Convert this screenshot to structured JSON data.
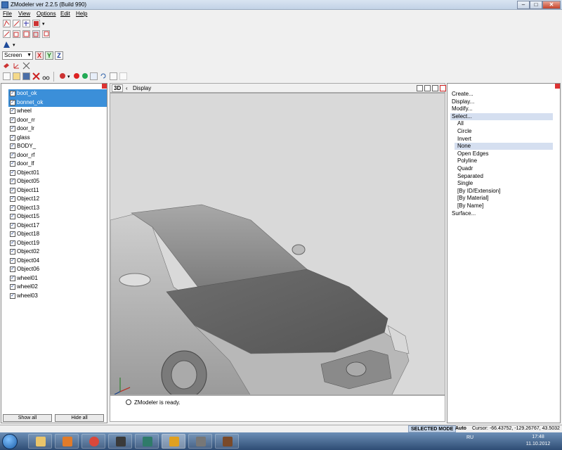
{
  "window": {
    "title": "ZModeler ver 2.2.5 (Build 990)",
    "min": "–",
    "max": "□",
    "close": "✕"
  },
  "menu": [
    "File",
    "View",
    "Options",
    "Edit",
    "Help"
  ],
  "toolbar": {
    "coord_mode": "Screen",
    "axes": [
      "X",
      "Y",
      "Z"
    ]
  },
  "objects": {
    "items": [
      {
        "label": "boot_ok",
        "selected": true
      },
      {
        "label": "bonnet_ok",
        "selected": true
      },
      {
        "label": "wheel"
      },
      {
        "label": "door_rr"
      },
      {
        "label": "door_lr"
      },
      {
        "label": "glass"
      },
      {
        "label": "BODY_"
      },
      {
        "label": "door_rf"
      },
      {
        "label": "door_lf"
      },
      {
        "label": "Object01"
      },
      {
        "label": "Object05"
      },
      {
        "label": "Object11"
      },
      {
        "label": "Object12"
      },
      {
        "label": "Object13"
      },
      {
        "label": "Object15"
      },
      {
        "label": "Object17"
      },
      {
        "label": "Object18"
      },
      {
        "label": "Object19"
      },
      {
        "label": "Object02"
      },
      {
        "label": "Object04"
      },
      {
        "label": "Object06"
      },
      {
        "label": "wheel01"
      },
      {
        "label": "wheel02"
      },
      {
        "label": "wheel03"
      }
    ],
    "show_all": "Show all",
    "hide_all": "Hide all"
  },
  "viewport": {
    "mode": "3D",
    "label": "Display",
    "arrow": "‹"
  },
  "message": "ZModeler is ready.",
  "commands": {
    "items": [
      {
        "label": "Create...",
        "level": 0
      },
      {
        "label": "Display...",
        "level": 0
      },
      {
        "label": "Modify...",
        "level": 0
      },
      {
        "label": "Select...",
        "level": 0,
        "highlight": true
      },
      {
        "label": "All",
        "level": 1
      },
      {
        "label": "Circle",
        "level": 1
      },
      {
        "label": "Invert",
        "level": 1
      },
      {
        "label": "None",
        "level": 1,
        "highlight": true
      },
      {
        "label": "Open Edges",
        "level": 1
      },
      {
        "label": "Polyline",
        "level": 1
      },
      {
        "label": "Quadr",
        "level": 1
      },
      {
        "label": "Separated",
        "level": 1
      },
      {
        "label": "Single",
        "level": 1
      },
      {
        "label": "[By ID/Extension]",
        "level": 1
      },
      {
        "label": "[By Material]",
        "level": 1
      },
      {
        "label": "[By Name]",
        "level": 1
      },
      {
        "label": "Surface...",
        "level": 0
      }
    ]
  },
  "status": {
    "mode": "SELECTED MODE",
    "auto": "Auto",
    "cursor": "Cursor: -66.43752, -129.26767, 43.5032"
  },
  "taskbar": {
    "tray_lang": "RU",
    "time": "17:48",
    "date": "11.10.2012"
  }
}
